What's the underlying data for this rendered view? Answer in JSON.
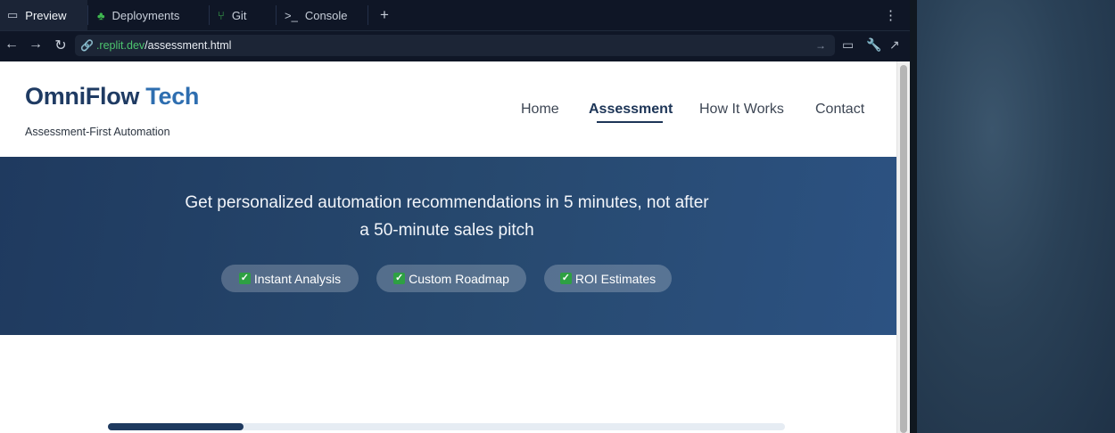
{
  "tabs": [
    {
      "label": "Preview",
      "icon": "monitor-icon"
    },
    {
      "label": "Deployments",
      "icon": "deployments-icon"
    },
    {
      "label": "Git",
      "icon": "git-branch-icon"
    },
    {
      "label": "Console",
      "icon": "terminal-icon"
    }
  ],
  "new_tab_label": "+",
  "url": {
    "domain": ".replit.dev",
    "path": "/assessment.html"
  },
  "site": {
    "logo_main": "OmniFlow",
    "logo_accent": "Tech",
    "tagline": "Assessment-First Automation",
    "nav": [
      "Home",
      "Assessment",
      "How It Works",
      "Contact"
    ],
    "active_nav": "Assessment"
  },
  "hero": {
    "subtitle": "Get personalized automation recommendations in 5 minutes, not after a 50-minute sales pitch",
    "features": [
      "Instant Analysis",
      "Custom Roadmap",
      "ROI Estimates"
    ]
  },
  "progress": {
    "fraction": 0.2
  },
  "colors": {
    "primary": "#1f3b63",
    "accent": "#2e6eb0",
    "check": "#2ea043"
  }
}
